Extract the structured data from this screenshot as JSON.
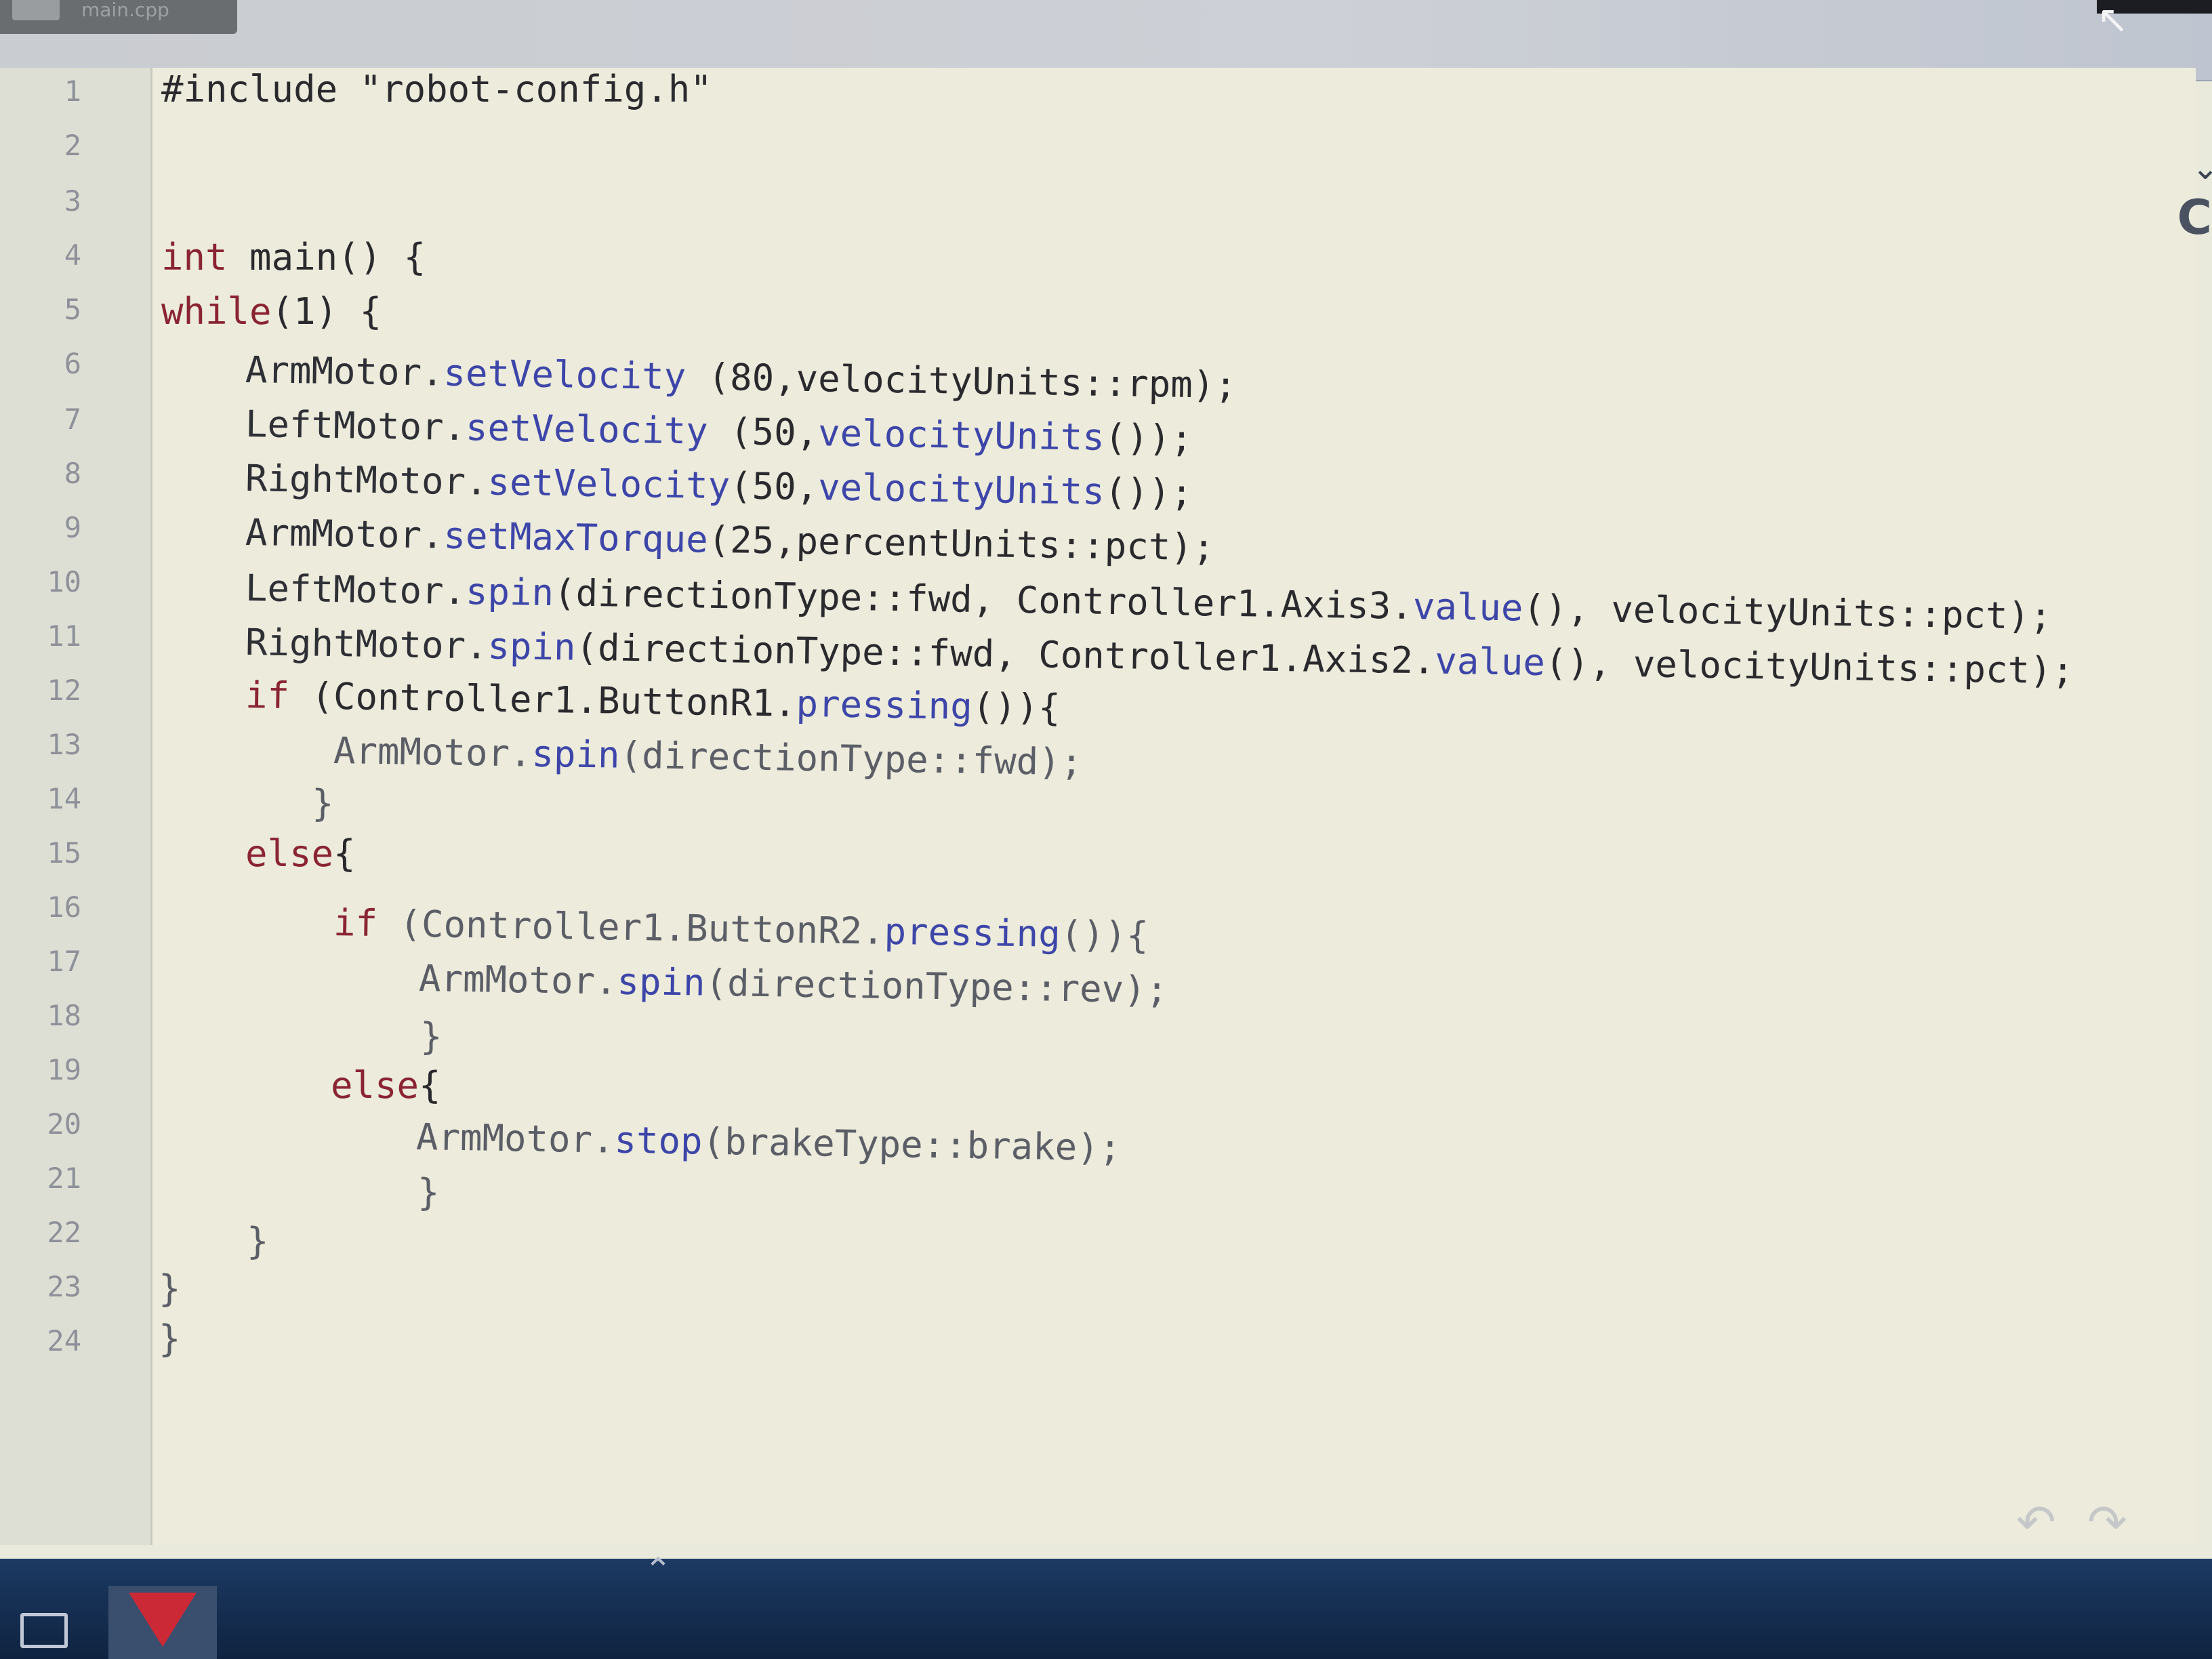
{
  "window": {
    "tab_name": "main.cpp"
  },
  "editor": {
    "line_numbers": [
      "1",
      "2",
      "3",
      "4",
      "5",
      "6",
      "7",
      "8",
      "9",
      "10",
      "11",
      "12",
      "13",
      "14",
      "15",
      "16",
      "17",
      "18",
      "19",
      "20",
      "21",
      "22",
      "23",
      "24"
    ],
    "lines": {
      "l1": "#include \"robot-config.h\"",
      "l4_kw": "int",
      "l4_rest": " main() {",
      "l5_kw": "while",
      "l5_rest": "(1) {",
      "l6_obj": "ArmMotor.",
      "l6_fn": "setVelocity",
      "l6_rest": " (80,velocityUnits::rpm);",
      "l7_obj": "LeftMotor.",
      "l7_fn": "setVelocity",
      "l7_rest": " (50,",
      "l7_fn2": "velocityUnits",
      "l7_end": "());",
      "l8_obj": "RightMotor.",
      "l8_fn": "setVelocity",
      "l8_rest": "(50,",
      "l8_fn2": "velocityUnits",
      "l8_end": "());",
      "l9_obj": "ArmMotor.",
      "l9_fn": "setMaxTorque",
      "l9_rest": "(25,percentUnits::pct);",
      "l10_obj": "LeftMotor.",
      "l10_fn": "spin",
      "l10_rest": "(directionType::fwd, Controller1.Axis3.",
      "l10_fn2": "value",
      "l10_end": "(), velocityUnits::pct);",
      "l11_obj": "RightMotor.",
      "l11_fn": "spin",
      "l11_rest": "(directionType::fwd, Controller1.Axis2.",
      "l11_fn2": "value",
      "l11_end": "(), velocityUnits::pct);",
      "l12_kw": "if",
      "l12_rest": " (Controller1.ButtonR1.",
      "l12_fn": "pressing",
      "l12_end": "()){",
      "l13_obj": "ArmMotor.",
      "l13_fn": "spin",
      "l13_rest": "(directionType::fwd);",
      "l14": "}",
      "l15_kw": "else",
      "l15_rest": "{",
      "l16_kw": "if",
      "l16_rest": " (Controller1.ButtonR2.",
      "l16_fn": "pressing",
      "l16_end": "()){",
      "l17_obj": "ArmMotor.",
      "l17_fn": "spin",
      "l17_rest": "(directionType::rev);",
      "l18": "}",
      "l19_kw": "else",
      "l19_rest": "{",
      "l20_obj": "ArmMotor.",
      "l20_fn": "stop",
      "l20_rest": "(brakeType::brake);",
      "l21": "}",
      "l22": "}",
      "l23": "}",
      "l24": "}"
    }
  },
  "icons": {
    "undo": "undo-arrow-icon",
    "redo": "redo-arrow-icon",
    "side_chevron": "chevron-down-icon",
    "side_letter": "C"
  },
  "colors": {
    "keyword": "#8a2433",
    "function": "#3d46a8",
    "editor_bg": "#ecebdc",
    "taskbar": "#1c3a63"
  }
}
